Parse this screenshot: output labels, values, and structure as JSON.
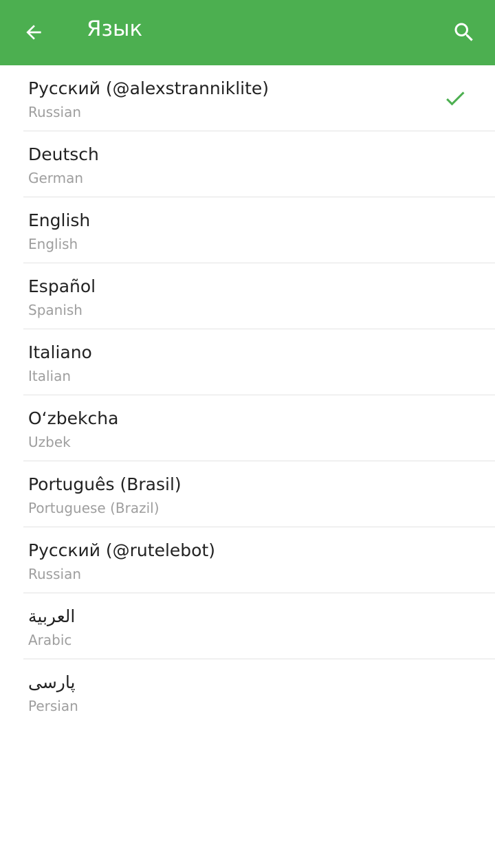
{
  "header": {
    "title": "Язык",
    "back_icon": "arrow-left-icon",
    "search_icon": "search-icon",
    "color": "#4caf50"
  },
  "languages": [
    {
      "name": "Русский (@alexstranniklite)",
      "subtitle": "Russian",
      "selected": true
    },
    {
      "name": "Deutsch",
      "subtitle": "German",
      "selected": false
    },
    {
      "name": "English",
      "subtitle": "English",
      "selected": false
    },
    {
      "name": "Español",
      "subtitle": "Spanish",
      "selected": false
    },
    {
      "name": "Italiano",
      "subtitle": "Italian",
      "selected": false
    },
    {
      "name": "O‘zbekcha",
      "subtitle": "Uzbek",
      "selected": false
    },
    {
      "name": "Português (Brasil)",
      "subtitle": "Portuguese (Brazil)",
      "selected": false
    },
    {
      "name": "Русский (@rutelebot)",
      "subtitle": "Russian",
      "selected": false
    },
    {
      "name": "العربية",
      "subtitle": "Arabic",
      "selected": false
    },
    {
      "name": "پارسی",
      "subtitle": "Persian",
      "selected": false
    }
  ],
  "check_icon": "checkmark-icon",
  "accent_color": "#4caf50"
}
